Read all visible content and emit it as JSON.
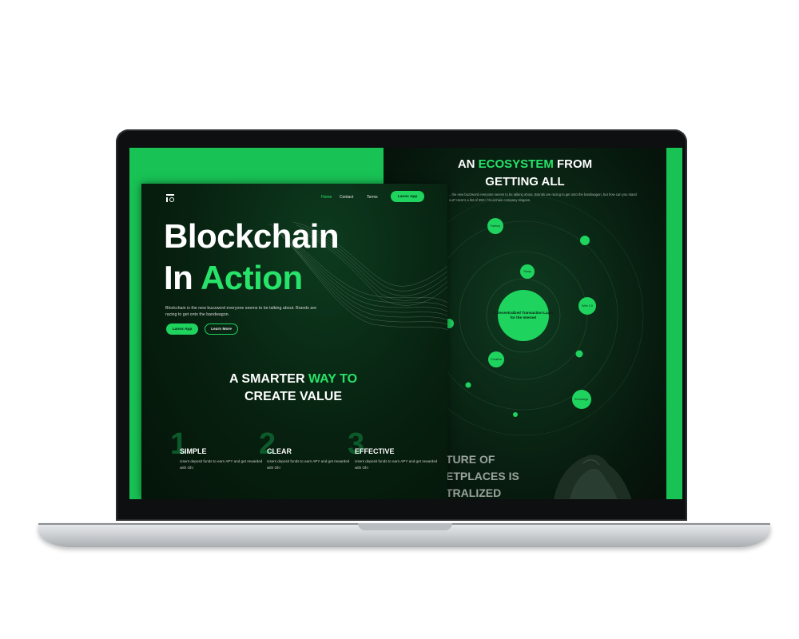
{
  "nav": {
    "items": [
      "Home",
      "Contact",
      "Terms"
    ],
    "cta": "Lanos App"
  },
  "hero": {
    "title_line1": "Blockchain",
    "title_line2_white": "In",
    "title_line2_accent": "Action",
    "description": "Blockchain is the new buzzword everyone seems to be talking about. Brands are racing to get onto the bandwagon.",
    "primary_button": "Lanos App",
    "secondary_button": "Learn More"
  },
  "value": {
    "line1_white": "A SMARTER",
    "line1_accent": "WAY TO",
    "line2": "CREATE VALUE"
  },
  "features": [
    {
      "num": "1",
      "title": "SIMPLE",
      "desc": "Users deposit funds to earn APY and get rewarded with Oh!"
    },
    {
      "num": "2",
      "title": "CLEAR",
      "desc": "Users deposit funds to earn APY and get rewarded with Oh!"
    },
    {
      "num": "3",
      "title": "EFFECTIVE",
      "desc": "Users deposit funds to earn APY and get rewarded with Oh!"
    }
  ],
  "ecosystem": {
    "title_white1": "AN",
    "title_accent": "ECOSYSTEM",
    "title_white2": "FROM",
    "title_line2": "GETTING ALL",
    "subtitle": "...the new buzzword everyone seems to be talking about. Brands are racing to get onto the bandwagon, but how can you stand out? Here's a list of 350+ blockchain company slogans.",
    "center_label": "A Decentralized Transaction Layer for the Internet",
    "nodes": [
      "Factory",
      "Swap",
      "Web 3.0",
      "Creative",
      "Exchange"
    ]
  },
  "bottom": {
    "line1": "TURE OF",
    "line2_accent": "ETPLACES",
    "line2_white": "IS",
    "line3": "TRALIZED"
  },
  "colors": {
    "accent": "#27e36a",
    "brand_green": "#18c254",
    "dark_bg": "#07200f"
  }
}
